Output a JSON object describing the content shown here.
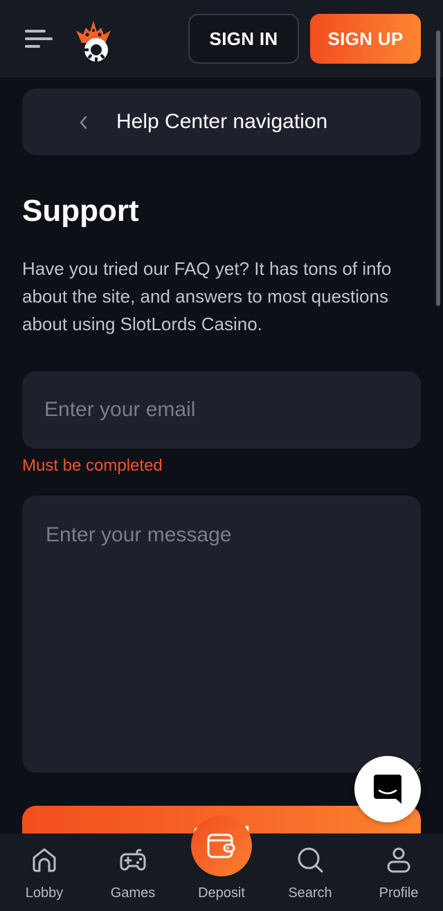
{
  "header": {
    "menu_icon": "hamburger-menu-icon",
    "logo_icon": "crown-chip-logo",
    "sign_in_label": "SIGN IN",
    "sign_up_label": "SIGN UP"
  },
  "help_nav": {
    "icon": "chevron-left-icon",
    "label": "Help Center navigation"
  },
  "page": {
    "title": "Support",
    "intro": "Have you tried our FAQ yet? It has tons of info about the site, and answers to most questions about using SlotLords Casino."
  },
  "form": {
    "email_placeholder": "Enter your email",
    "email_value": "",
    "email_error": "Must be completed",
    "message_placeholder": "Enter your message",
    "message_value": "",
    "submit_label": "Send"
  },
  "chat": {
    "icon": "chat-bubble-smile-icon"
  },
  "bottom_nav": {
    "items": [
      {
        "label": "Lobby",
        "icon": "home-icon"
      },
      {
        "label": "Games",
        "icon": "gamepad-icon"
      },
      {
        "label": "Deposit",
        "icon": "wallet-icon"
      },
      {
        "label": "Search",
        "icon": "search-icon"
      },
      {
        "label": "Profile",
        "icon": "user-icon"
      }
    ]
  },
  "colors": {
    "accent_start": "#f24e1e",
    "accent_end": "#fc8430",
    "background": "#0d1016",
    "surface": "#1e212c",
    "header": "#161a23",
    "error": "#f5522b"
  }
}
